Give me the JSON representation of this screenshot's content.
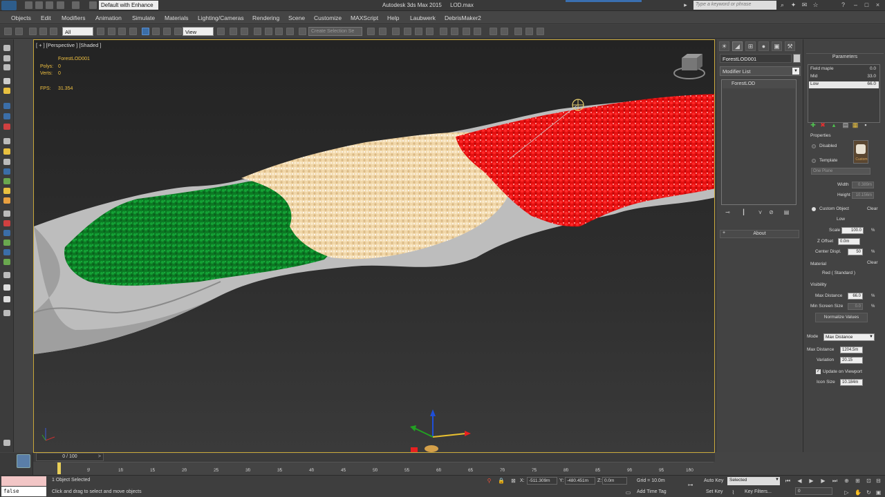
{
  "title_bar": {
    "workspace": "Default with Enhance",
    "app_name": "Autodesk 3ds Max 2015",
    "file_name": "LOD.max",
    "search_placeholder": "Type a keyword or phrase"
  },
  "menu": [
    "Objects",
    "Edit",
    "Modifiers",
    "Animation",
    "Simulate",
    "Materials",
    "Lighting/Cameras",
    "Rendering",
    "Scene",
    "Customize",
    "MAXScript",
    "Help",
    "Laubwerk",
    "DebrisMaker2"
  ],
  "toolbar": {
    "selection_filter": "All",
    "reference_coord": "View",
    "named_selection_placeholder": "Create Selection Se"
  },
  "viewport": {
    "label": "[ + ] [Perspective ] [Shaded ]",
    "object_name": "ForestLOD001",
    "polys_label": "Polys:",
    "polys_value": "0",
    "verts_label": "Verts:",
    "verts_value": "0",
    "fps_label": "FPS:",
    "fps_value": "31.354"
  },
  "command_panel": {
    "object_name": "ForestLOD001",
    "modifier_list": "Modifier List",
    "stack_item": "ForestLOD",
    "about": "About"
  },
  "parameters": {
    "title": "Parameters",
    "lod_levels": [
      {
        "name": "Field maple",
        "value": "0.0"
      },
      {
        "name": "Mid",
        "value": "33.0"
      },
      {
        "name": "Low",
        "value": "66.0",
        "selected": true
      }
    ],
    "properties_label": "Properties",
    "disabled_label": "Disabled",
    "template_label": "Template",
    "template_value": "One Plane",
    "width_label": "Width",
    "width_value": "0.389m",
    "height_label": "Height",
    "height_value": "10.156m",
    "custom_label": "Custom",
    "custom_object_label": "Custom Object",
    "clear_label": "Clear",
    "custom_object_value": "Low",
    "scale_label": "Scale",
    "scale_value": "100.0",
    "zoffset_label": "Z Offset",
    "zoffset_value": "0.0m",
    "center_label": "Center Displ.",
    "center_value": "50",
    "material_label": "Material",
    "material_clear": "Clear",
    "material_value": "Red ( Standard )",
    "visibility_label": "Visibility",
    "max_distance_label": "Max Distance",
    "max_distance_value": "66.0",
    "min_screen_label": "Min Screen Size",
    "min_screen_value": "0.0",
    "normalize_label": "Normalize Values",
    "mode_label": "Mode",
    "mode_value": "Max Distance",
    "mode_max_distance_label": "Max Distance",
    "mode_max_distance_value": "1204.5m",
    "variation_label": "Variation",
    "variation_value": "20.15",
    "update_viewport_label": "Update on Viewport",
    "icon_size_label": "Icon Size",
    "icon_size_value": "10.184m",
    "percent": "%"
  },
  "timeline": {
    "slider": "0 / 100",
    "ticks": [
      "5",
      "10",
      "15",
      "20",
      "25",
      "30",
      "35",
      "40",
      "45",
      "50",
      "55",
      "60",
      "65",
      "70",
      "75",
      "80",
      "85",
      "90",
      "95",
      "100"
    ]
  },
  "status": {
    "maxscript_value": "false",
    "selected": "1 Object Selected",
    "prompt": "Click and drag to select and move objects",
    "x_label": "X:",
    "x_value": "-511.309m",
    "y_label": "Y:",
    "y_value": "-480.451m",
    "z_label": "Z:",
    "z_value": "0.0m",
    "grid": "Grid = 10.0m",
    "add_time_tag": "Add Time Tag",
    "auto_key": "Auto Key",
    "set_key": "Set Key",
    "auto_key_mode": "Selected",
    "key_filters": "Key Filters...",
    "frame": "0"
  },
  "colors": {
    "accent": "#3b6ea8",
    "forest_high": "#0e8a2a",
    "forest_mid": "#f2d8a8",
    "forest_low": "#ee1111",
    "viewport_border": "#c9a83a"
  }
}
